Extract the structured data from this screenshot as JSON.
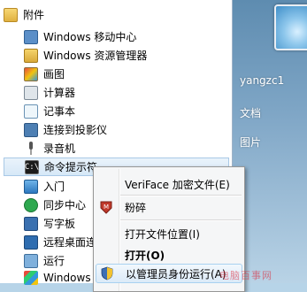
{
  "menu_folder": {
    "label": "附件"
  },
  "programs": [
    {
      "label": "Windows 移动中心",
      "icon": "mobility-center-icon"
    },
    {
      "label": "Windows 资源管理器",
      "icon": "explorer-icon"
    },
    {
      "label": "画图",
      "icon": "paint-icon"
    },
    {
      "label": "计算器",
      "icon": "calculator-icon"
    },
    {
      "label": "记事本",
      "icon": "notepad-icon"
    },
    {
      "label": "连接到投影仪",
      "icon": "projector-icon"
    },
    {
      "label": "录音机",
      "icon": "microphone-icon"
    },
    {
      "label": "命令提示符",
      "icon": "cmd-icon",
      "selected": true
    },
    {
      "label": "入门",
      "icon": "getting-started-icon"
    },
    {
      "label": "同步中心",
      "icon": "sync-icon"
    },
    {
      "label": "写字板",
      "icon": "wordpad-icon"
    },
    {
      "label": "远程桌面连",
      "icon": "remote-desktop-icon"
    },
    {
      "label": "运行",
      "icon": "run-icon"
    },
    {
      "label": "Windows",
      "icon": "windows-icon"
    }
  ],
  "right_pane": {
    "username": "yangzc1",
    "documents": "文档",
    "pictures": "图片"
  },
  "context_menu": {
    "items": [
      {
        "label": "VeriFace 加密文件(E)",
        "icon": ""
      },
      {
        "label": "粉碎",
        "icon": "shred-icon"
      },
      {
        "label": "打开文件位置(I)",
        "icon": ""
      },
      {
        "label": "打开(O)",
        "icon": "",
        "bold": true
      },
      {
        "label": "以管理员身份运行(A)",
        "icon": "uac-shield-icon",
        "hot": true
      }
    ]
  },
  "watermark": "电脑百事网",
  "colors": {
    "accent": "#3f8fc9",
    "cmd_icon_bg": "#1b1b1b",
    "shield": "#c0392b"
  }
}
